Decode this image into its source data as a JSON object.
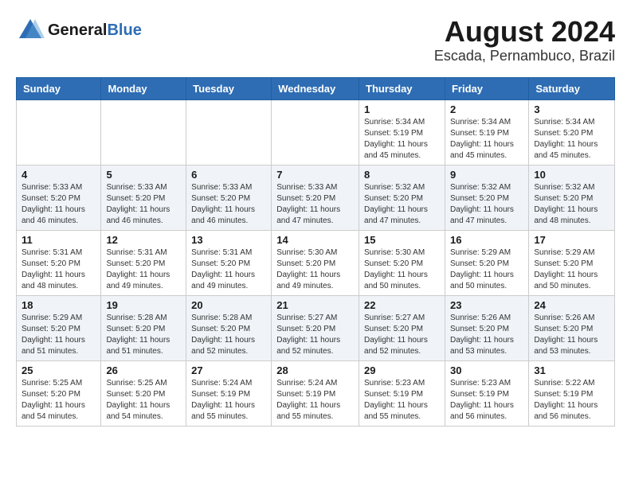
{
  "header": {
    "logo_general": "General",
    "logo_blue": "Blue",
    "month_title": "August 2024",
    "location": "Escada, Pernambuco, Brazil"
  },
  "weekdays": [
    "Sunday",
    "Monday",
    "Tuesday",
    "Wednesday",
    "Thursday",
    "Friday",
    "Saturday"
  ],
  "weeks": [
    [
      {
        "day": "",
        "info": ""
      },
      {
        "day": "",
        "info": ""
      },
      {
        "day": "",
        "info": ""
      },
      {
        "day": "",
        "info": ""
      },
      {
        "day": "1",
        "info": "Sunrise: 5:34 AM\nSunset: 5:19 PM\nDaylight: 11 hours\nand 45 minutes."
      },
      {
        "day": "2",
        "info": "Sunrise: 5:34 AM\nSunset: 5:19 PM\nDaylight: 11 hours\nand 45 minutes."
      },
      {
        "day": "3",
        "info": "Sunrise: 5:34 AM\nSunset: 5:20 PM\nDaylight: 11 hours\nand 45 minutes."
      }
    ],
    [
      {
        "day": "4",
        "info": "Sunrise: 5:33 AM\nSunset: 5:20 PM\nDaylight: 11 hours\nand 46 minutes."
      },
      {
        "day": "5",
        "info": "Sunrise: 5:33 AM\nSunset: 5:20 PM\nDaylight: 11 hours\nand 46 minutes."
      },
      {
        "day": "6",
        "info": "Sunrise: 5:33 AM\nSunset: 5:20 PM\nDaylight: 11 hours\nand 46 minutes."
      },
      {
        "day": "7",
        "info": "Sunrise: 5:33 AM\nSunset: 5:20 PM\nDaylight: 11 hours\nand 47 minutes."
      },
      {
        "day": "8",
        "info": "Sunrise: 5:32 AM\nSunset: 5:20 PM\nDaylight: 11 hours\nand 47 minutes."
      },
      {
        "day": "9",
        "info": "Sunrise: 5:32 AM\nSunset: 5:20 PM\nDaylight: 11 hours\nand 47 minutes."
      },
      {
        "day": "10",
        "info": "Sunrise: 5:32 AM\nSunset: 5:20 PM\nDaylight: 11 hours\nand 48 minutes."
      }
    ],
    [
      {
        "day": "11",
        "info": "Sunrise: 5:31 AM\nSunset: 5:20 PM\nDaylight: 11 hours\nand 48 minutes."
      },
      {
        "day": "12",
        "info": "Sunrise: 5:31 AM\nSunset: 5:20 PM\nDaylight: 11 hours\nand 49 minutes."
      },
      {
        "day": "13",
        "info": "Sunrise: 5:31 AM\nSunset: 5:20 PM\nDaylight: 11 hours\nand 49 minutes."
      },
      {
        "day": "14",
        "info": "Sunrise: 5:30 AM\nSunset: 5:20 PM\nDaylight: 11 hours\nand 49 minutes."
      },
      {
        "day": "15",
        "info": "Sunrise: 5:30 AM\nSunset: 5:20 PM\nDaylight: 11 hours\nand 50 minutes."
      },
      {
        "day": "16",
        "info": "Sunrise: 5:29 AM\nSunset: 5:20 PM\nDaylight: 11 hours\nand 50 minutes."
      },
      {
        "day": "17",
        "info": "Sunrise: 5:29 AM\nSunset: 5:20 PM\nDaylight: 11 hours\nand 50 minutes."
      }
    ],
    [
      {
        "day": "18",
        "info": "Sunrise: 5:29 AM\nSunset: 5:20 PM\nDaylight: 11 hours\nand 51 minutes."
      },
      {
        "day": "19",
        "info": "Sunrise: 5:28 AM\nSunset: 5:20 PM\nDaylight: 11 hours\nand 51 minutes."
      },
      {
        "day": "20",
        "info": "Sunrise: 5:28 AM\nSunset: 5:20 PM\nDaylight: 11 hours\nand 52 minutes."
      },
      {
        "day": "21",
        "info": "Sunrise: 5:27 AM\nSunset: 5:20 PM\nDaylight: 11 hours\nand 52 minutes."
      },
      {
        "day": "22",
        "info": "Sunrise: 5:27 AM\nSunset: 5:20 PM\nDaylight: 11 hours\nand 52 minutes."
      },
      {
        "day": "23",
        "info": "Sunrise: 5:26 AM\nSunset: 5:20 PM\nDaylight: 11 hours\nand 53 minutes."
      },
      {
        "day": "24",
        "info": "Sunrise: 5:26 AM\nSunset: 5:20 PM\nDaylight: 11 hours\nand 53 minutes."
      }
    ],
    [
      {
        "day": "25",
        "info": "Sunrise: 5:25 AM\nSunset: 5:20 PM\nDaylight: 11 hours\nand 54 minutes."
      },
      {
        "day": "26",
        "info": "Sunrise: 5:25 AM\nSunset: 5:20 PM\nDaylight: 11 hours\nand 54 minutes."
      },
      {
        "day": "27",
        "info": "Sunrise: 5:24 AM\nSunset: 5:19 PM\nDaylight: 11 hours\nand 55 minutes."
      },
      {
        "day": "28",
        "info": "Sunrise: 5:24 AM\nSunset: 5:19 PM\nDaylight: 11 hours\nand 55 minutes."
      },
      {
        "day": "29",
        "info": "Sunrise: 5:23 AM\nSunset: 5:19 PM\nDaylight: 11 hours\nand 55 minutes."
      },
      {
        "day": "30",
        "info": "Sunrise: 5:23 AM\nSunset: 5:19 PM\nDaylight: 11 hours\nand 56 minutes."
      },
      {
        "day": "31",
        "info": "Sunrise: 5:22 AM\nSunset: 5:19 PM\nDaylight: 11 hours\nand 56 minutes."
      }
    ]
  ]
}
